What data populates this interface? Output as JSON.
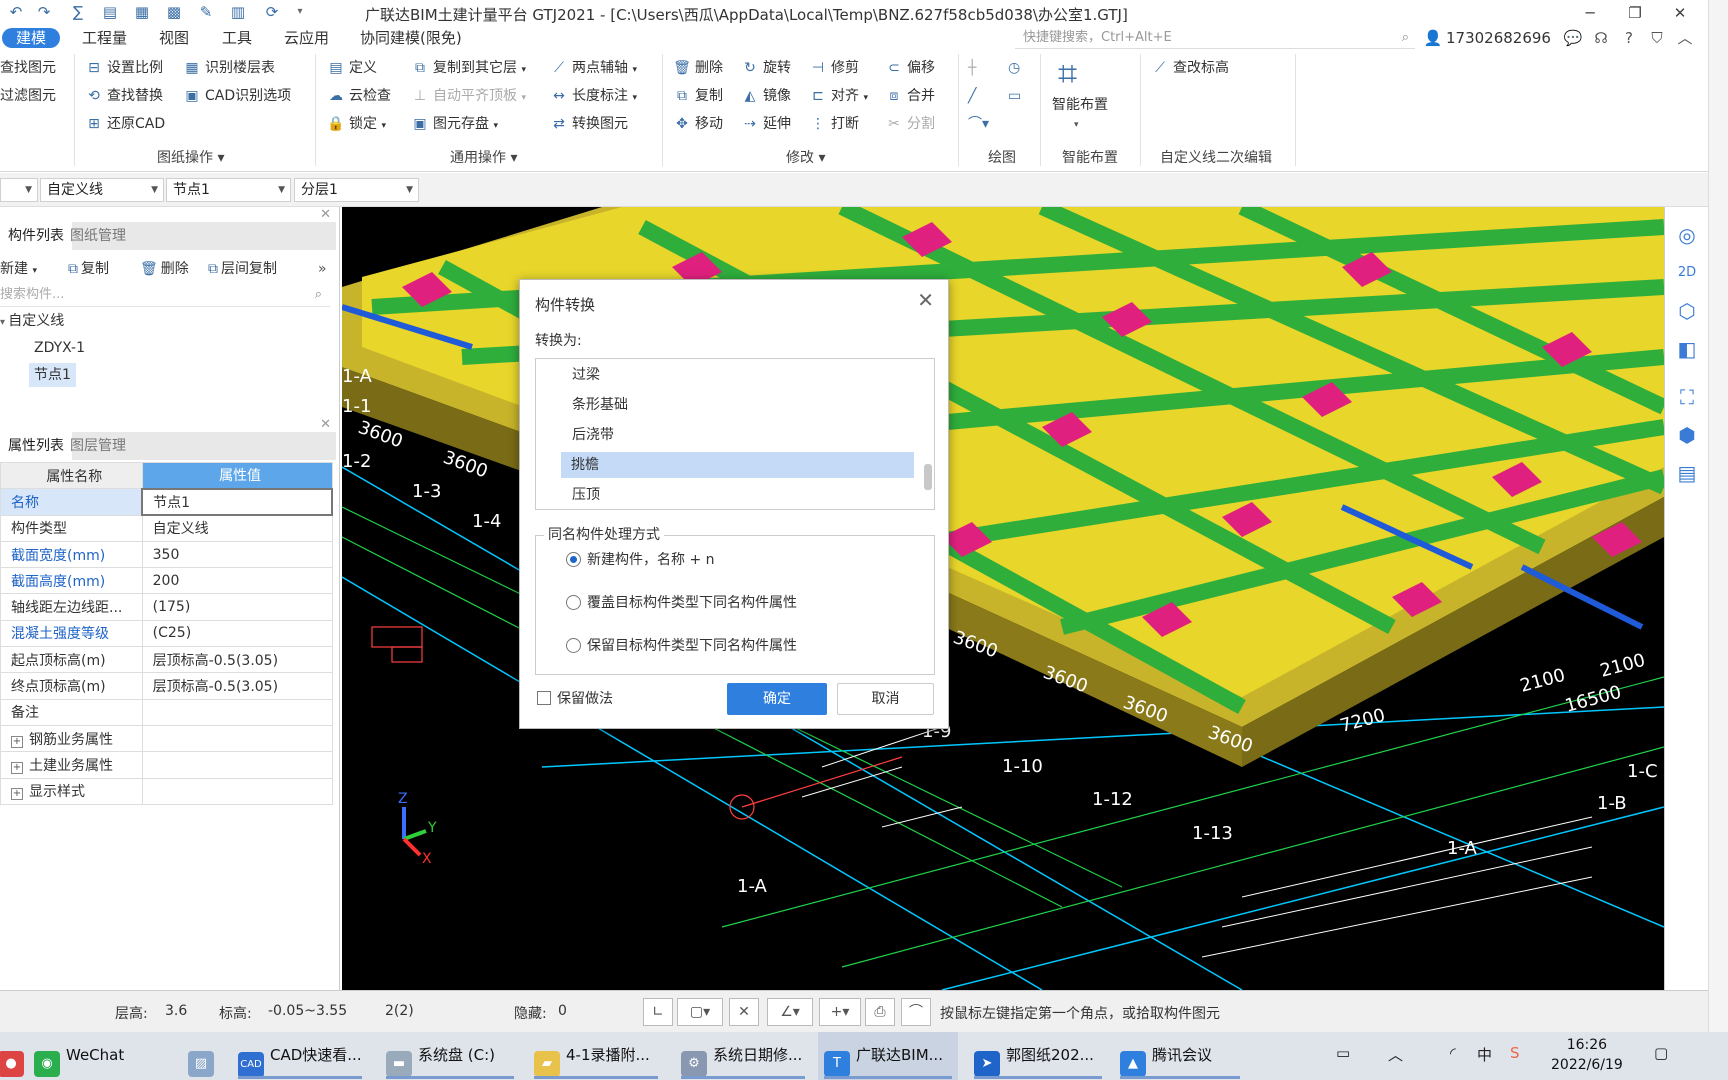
{
  "app": {
    "title": "广联达BIM土建计量平台 GTJ2021 - [C:\\Users\\西瓜\\AppData\\Local\\Temp\\BNZ.627f58cb5d038\\办公室1.GTJ]"
  },
  "menu": {
    "items": [
      "建模",
      "工程量",
      "视图",
      "工具",
      "云应用",
      "协同建模(限免)"
    ],
    "search_placeholder": "快捷键搜索，Ctrl+Alt+E",
    "user_id": "17302682696"
  },
  "ribbon": {
    "col0": [
      "查找图元",
      "过滤图元"
    ],
    "drawing_ops": {
      "label": "图纸操作",
      "items": [
        "设置比例",
        "识别楼层表",
        "查找替换",
        "CAD识别选项",
        "还原CAD"
      ]
    },
    "general_ops": {
      "label": "通用操作",
      "items": [
        "定义",
        "复制到其它层",
        "两点辅轴",
        "云检查",
        "自动平齐顶板",
        "长度标注",
        "锁定",
        "图元存盘",
        "转换图元"
      ]
    },
    "modify": {
      "label": "修改",
      "items": [
        "删除",
        "旋转",
        "修剪",
        "偏移",
        "复制",
        "镜像",
        "对齐",
        "合并",
        "移动",
        "延伸",
        "打断",
        "分割"
      ]
    },
    "draw": {
      "label": "绘图"
    },
    "smart": {
      "label": "智能布置",
      "button": "智能布置"
    },
    "custom_line": {
      "label": "自定义线二次编辑",
      "button": "查改标高"
    }
  },
  "dropdowns": [
    "自定义线",
    "节点1",
    "分层1"
  ],
  "component_panel": {
    "tabs": [
      "构件列表",
      "图纸管理"
    ],
    "tools": [
      "新建",
      "复制",
      "删除",
      "层间复制"
    ],
    "search_placeholder": "搜索构件...",
    "tree_root": "自定义线",
    "tree_items": [
      "ZDYX-1",
      "节点1"
    ]
  },
  "property_panel": {
    "tabs": [
      "属性列表",
      "图层管理"
    ],
    "headers": [
      "属性名称",
      "属性值"
    ],
    "rows": [
      {
        "name": "名称",
        "value": "节点1"
      },
      {
        "name": "构件类型",
        "value": "自定义线"
      },
      {
        "name": "截面宽度(mm)",
        "value": "350"
      },
      {
        "name": "截面高度(mm)",
        "value": "200"
      },
      {
        "name": "轴线距左边线距...",
        "value": "(175)"
      },
      {
        "name": "混凝土强度等级",
        "value": "(C25)"
      },
      {
        "name": "起点顶标高(m)",
        "value": "层顶标高-0.5(3.05)"
      },
      {
        "name": "终点顶标高(m)",
        "value": "层顶标高-0.5(3.05)"
      },
      {
        "name": "备注",
        "value": ""
      },
      {
        "name": "钢筋业务属性",
        "value": ""
      },
      {
        "name": "土建业务属性",
        "value": ""
      },
      {
        "name": "显示样式",
        "value": ""
      }
    ]
  },
  "viewport": {
    "axis_labels": [
      "1-A",
      "1-1",
      "1-2",
      "1-3",
      "1-4",
      "1-9",
      "1-10",
      "1-12",
      "1-13",
      "1-A",
      "1-A",
      "1-B",
      "1-C"
    ],
    "dimensions": [
      "3600",
      "3600",
      "3600",
      "3600",
      "3600",
      "3600",
      "7200",
      "2100",
      "16500",
      "2100"
    ],
    "axis_gizmo": [
      "Z",
      "Y",
      "X"
    ]
  },
  "dialog": {
    "title": "构件转换",
    "convert_label": "转换为:",
    "list_items": [
      "过梁",
      "条形基础",
      "后浇带",
      "挑檐",
      "压顶"
    ],
    "selected_index": 3,
    "group_label": "同名构件处理方式",
    "options": [
      "新建构件，名称 + n",
      "覆盖目标构件类型下同名构件属性",
      "保留目标构件类型下同名构件属性"
    ],
    "selected_option": 0,
    "keep_method": "保留做法",
    "ok": "确定",
    "cancel": "取消"
  },
  "status": {
    "floor_height_label": "层高:",
    "floor_height": "3.6",
    "elevation_label": "标高:",
    "elevation": "-0.05~3.55",
    "count": "2(2)",
    "hidden_label": "隐藏:",
    "hidden": "0",
    "hint": "按鼠标左键指定第一个角点，或拾取构件图元"
  },
  "taskbar": {
    "items": [
      "WeChat",
      "CAD快速看...",
      "系统盘 (C:)",
      "4-1录播附...",
      "系统日期修...",
      "广联达BIM...",
      "郭图纸202...",
      "腾讯会议"
    ],
    "tray_lang": "中",
    "time": "16:26",
    "date": "2022/6/19"
  },
  "colors": {
    "accent": "#2f7fde",
    "slab": "#e8d62a",
    "wall": "#2fae3c",
    "column": "#e0207e",
    "axis": "#00c8ff",
    "viewport_bg": "#000000"
  }
}
